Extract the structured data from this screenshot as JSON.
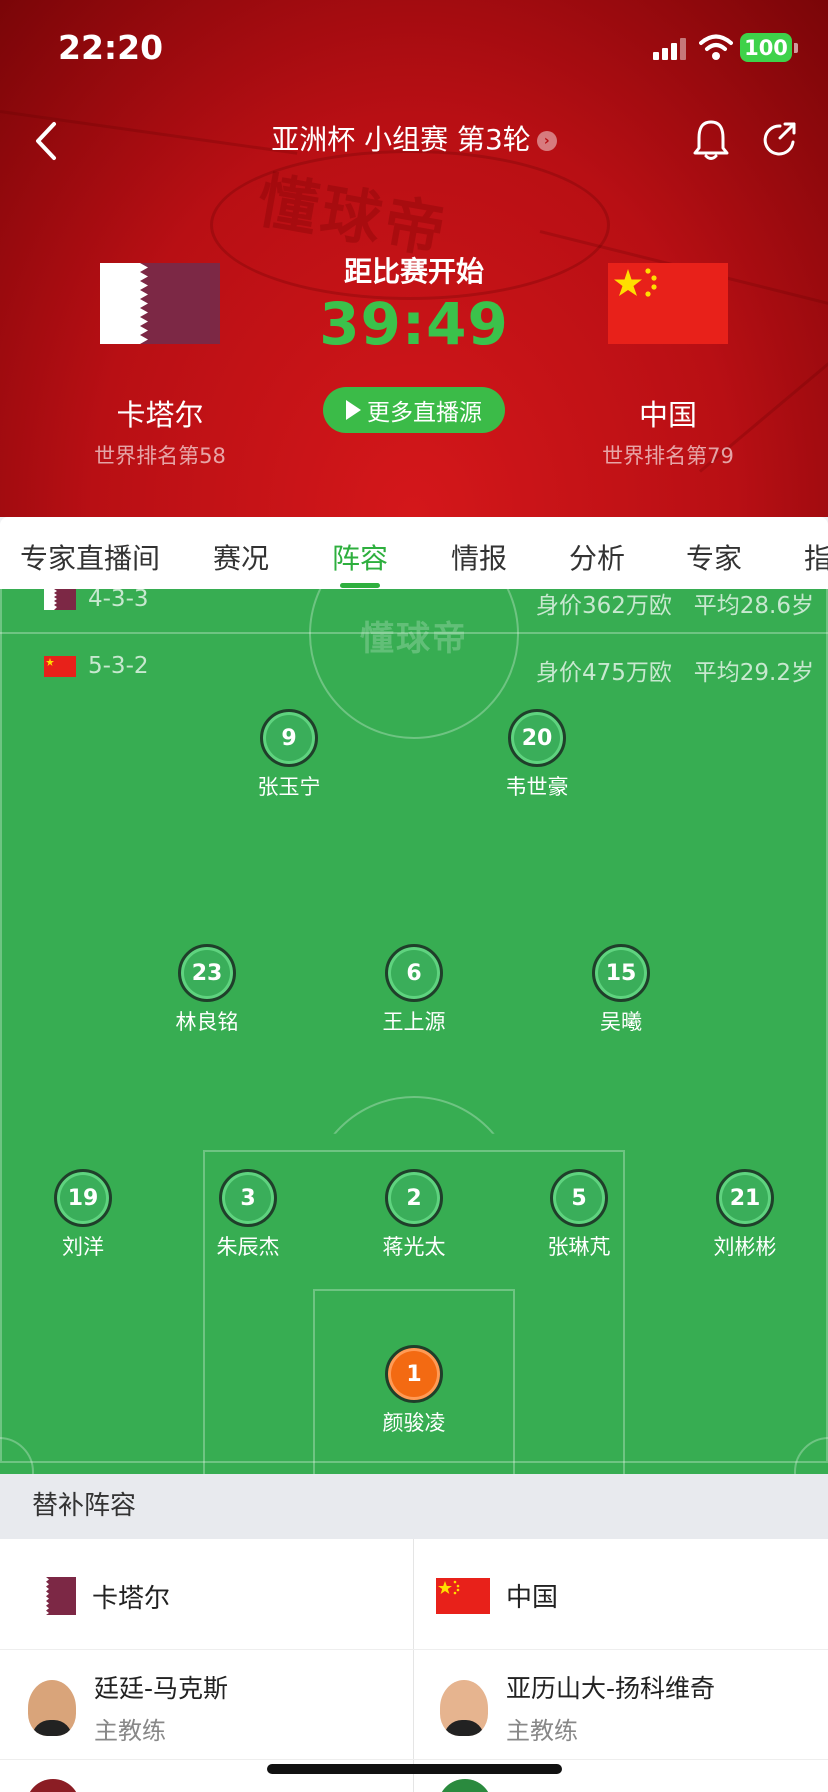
{
  "status_bar": {
    "time": "22:20",
    "battery": "100"
  },
  "nav": {
    "title": "亚洲杯 小组赛 第3轮",
    "title_chevron": "›"
  },
  "watermark": "懂球帝",
  "match": {
    "countdown_label": "距比赛开始",
    "countdown": "39:49",
    "live_button": "更多直播源",
    "home": {
      "name": "卡塔尔",
      "rank": "世界排名第58"
    },
    "away": {
      "name": "中国",
      "rank": "世界排名第79"
    }
  },
  "tabs": [
    "专家直播间",
    "赛况",
    "阵容",
    "情报",
    "分析",
    "专家",
    "指"
  ],
  "active_tab": "阵容",
  "lineup": {
    "home_formation": "4-3-3",
    "home_value": "身价362万欧",
    "home_age": "平均28.6岁",
    "away_formation": "5-3-2",
    "away_value": "身价475万欧",
    "away_age": "平均29.2岁",
    "players": [
      {
        "number": "9",
        "name": "张玉宁"
      },
      {
        "number": "20",
        "name": "韦世豪"
      },
      {
        "number": "23",
        "name": "林良铭"
      },
      {
        "number": "6",
        "name": "王上源"
      },
      {
        "number": "15",
        "name": "吴曦"
      },
      {
        "number": "19",
        "name": "刘洋"
      },
      {
        "number": "3",
        "name": "朱辰杰"
      },
      {
        "number": "2",
        "name": "蒋光太"
      },
      {
        "number": "5",
        "name": "张琳芃"
      },
      {
        "number": "21",
        "name": "刘彬彬"
      },
      {
        "number": "1",
        "name": "颜骏凌"
      }
    ]
  },
  "subs": {
    "header": "替补阵容",
    "home_team": "卡塔尔",
    "away_team": "中国",
    "home_coach": {
      "name": "廷廷-马克斯",
      "role": "主教练"
    },
    "away_coach": {
      "name": "亚历山大-扬科维奇",
      "role": "主教练"
    }
  },
  "colors": {
    "header_red": "#b80f14",
    "accent_green": "#2eaf3e",
    "pitch_green": "#37ad52",
    "goalkeeper_orange": "#f36a12"
  }
}
